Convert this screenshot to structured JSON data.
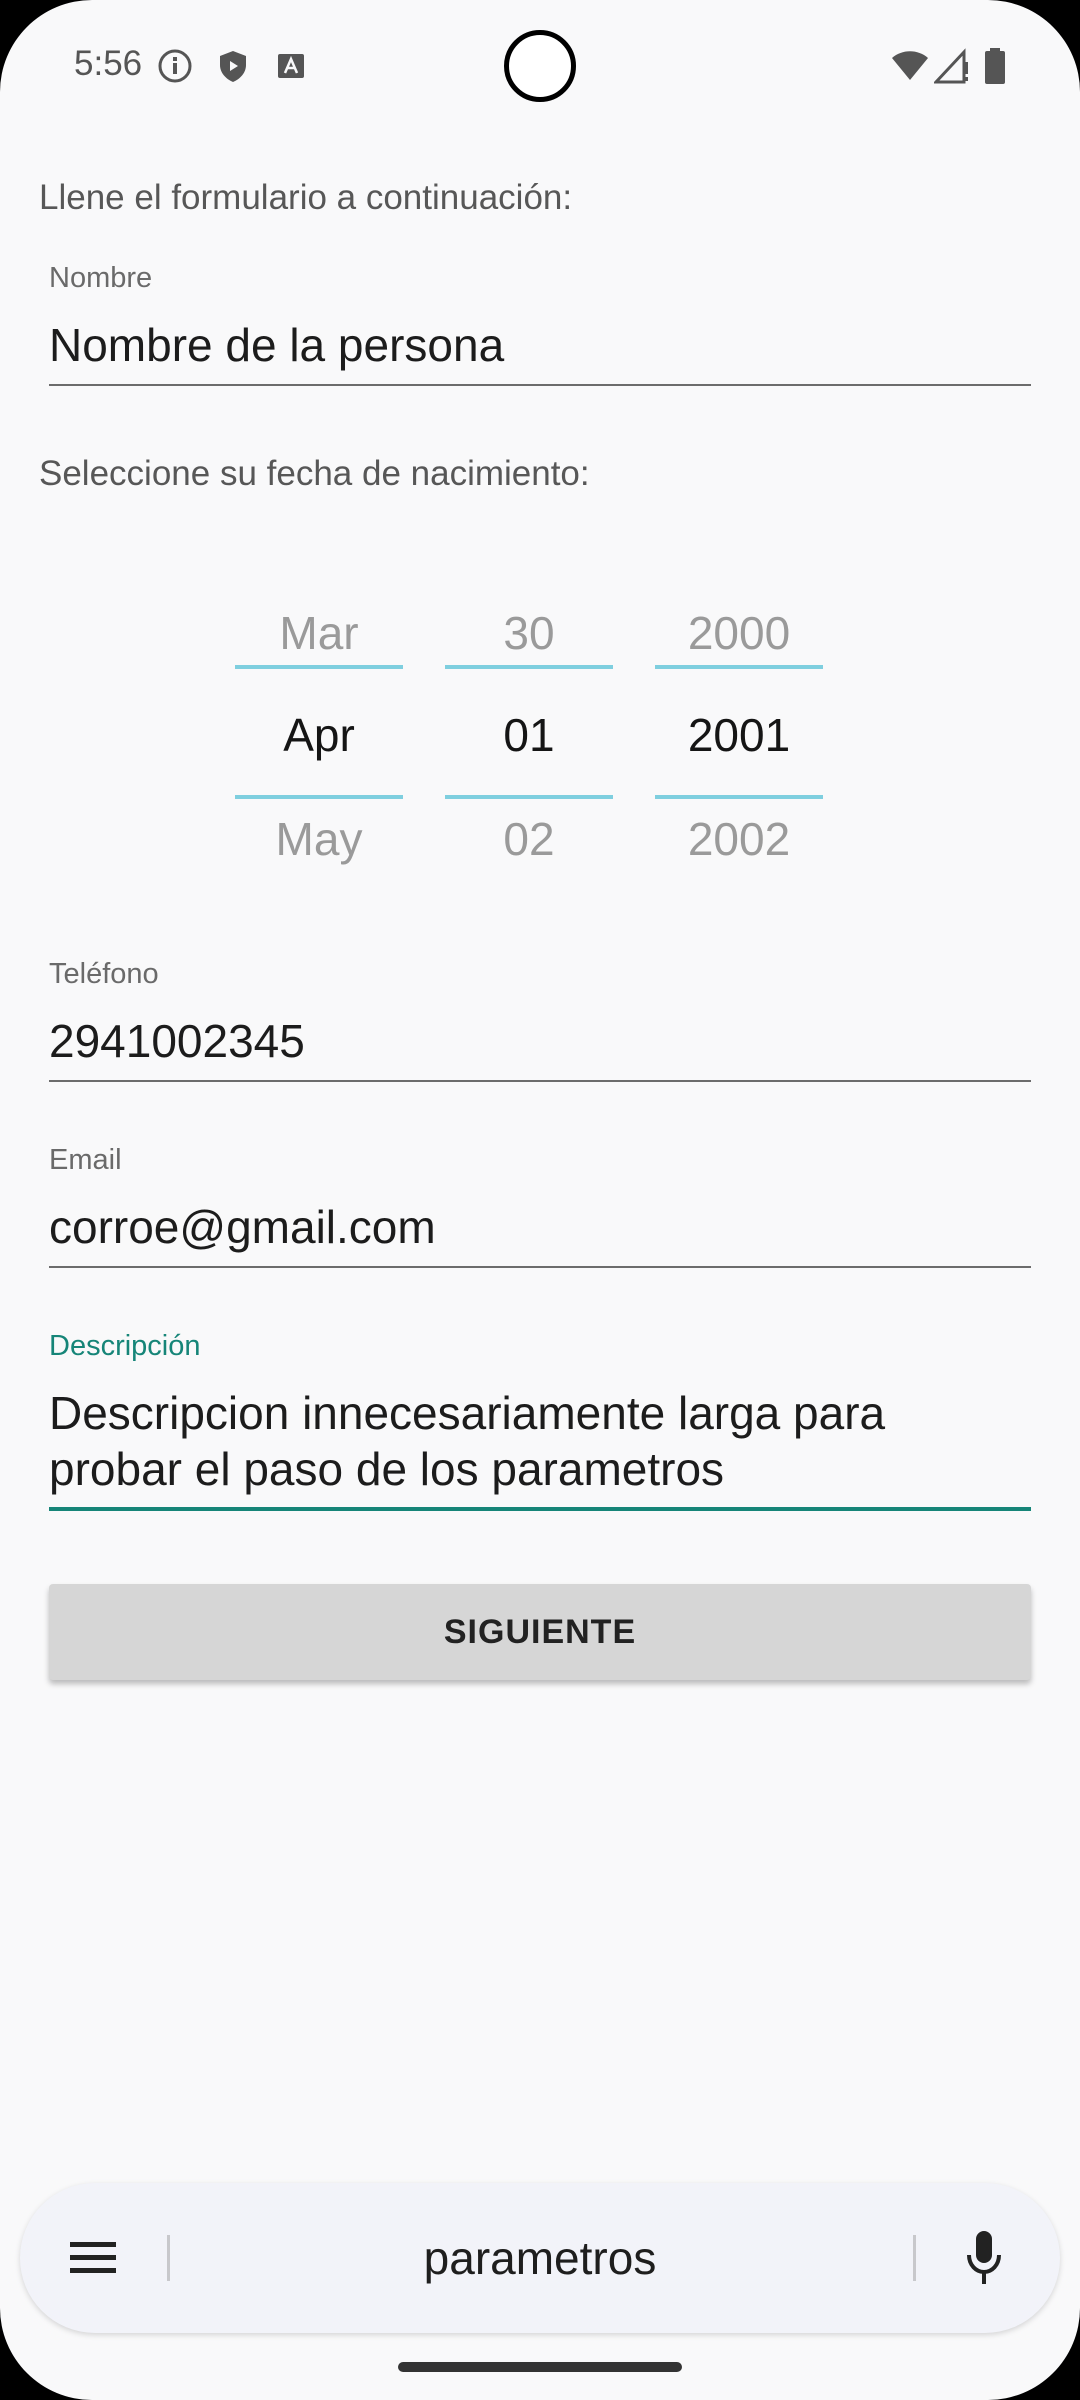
{
  "status_bar": {
    "time": "5:56",
    "icons_left": [
      "info-icon",
      "shield-icon",
      "keyboard-a-icon"
    ],
    "icons_right": [
      "wifi-icon",
      "cell-signal-icon",
      "battery-icon"
    ]
  },
  "form": {
    "intro": "Llene el formulario a continuación:",
    "name": {
      "label": "Nombre",
      "value": "Nombre de la persona"
    },
    "birth_prompt": "Seleccione su fecha de nacimiento:",
    "date_picker": {
      "month": {
        "prev": "Mar",
        "selected": "Apr",
        "next": "May"
      },
      "day": {
        "prev": "30",
        "selected": "01",
        "next": "02"
      },
      "year": {
        "prev": "2000",
        "selected": "2001",
        "next": "2002"
      }
    },
    "phone": {
      "label": "Teléfono",
      "value": "2941002345"
    },
    "email": {
      "label": "Email",
      "value": "corroe@gmail.com"
    },
    "description": {
      "label": "Descripción",
      "line1": "Descripcion innecesariamente larga para",
      "line2": "probar el paso de los parametros"
    },
    "next_button": "SIGUIENTE"
  },
  "keyboard_bar": {
    "suggestion": "parametros",
    "menu_icon": "menu-icon",
    "mic_icon": "microphone-icon"
  },
  "colors": {
    "accent": "#168578",
    "picker_divider": "#7fcfdf",
    "background": "#f9f9fa",
    "button": "#d6d6d6"
  }
}
